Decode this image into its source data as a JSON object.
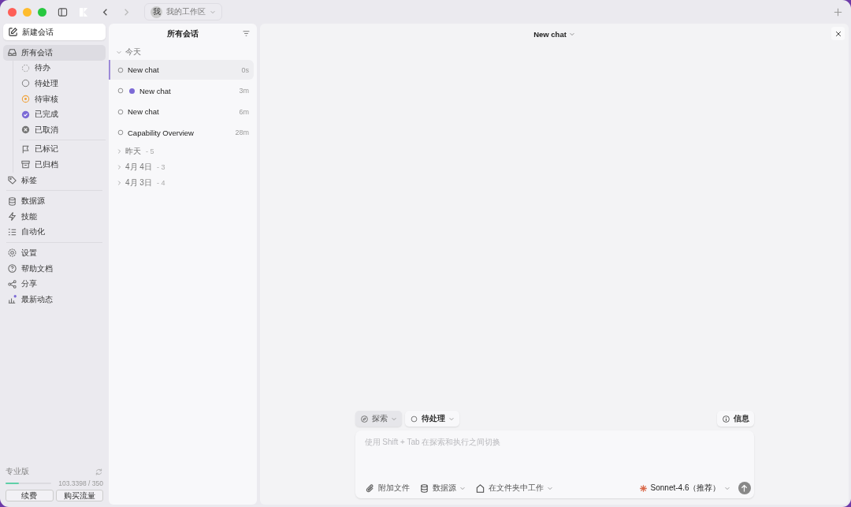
{
  "titlebar": {
    "workspace": "我的工作区",
    "workspace_initial": "我"
  },
  "sidebar": {
    "new_chat": "新建会话",
    "all": {
      "label": "所有会话",
      "selected": true
    },
    "statuses": [
      {
        "label": "待办",
        "kind": "todo"
      },
      {
        "label": "待处理",
        "kind": "pending"
      },
      {
        "label": "待审核",
        "kind": "review"
      },
      {
        "label": "已完成",
        "kind": "done"
      },
      {
        "label": "已取消",
        "kind": "cancelled"
      }
    ],
    "marks": [
      {
        "label": "已标记",
        "kind": "flag"
      },
      {
        "label": "已归档",
        "kind": "archive"
      }
    ],
    "groups": [
      [
        {
          "label": "标签",
          "kind": "tag"
        }
      ],
      [
        {
          "label": "数据源",
          "kind": "database"
        },
        {
          "label": "技能",
          "kind": "bolt"
        },
        {
          "label": "自动化",
          "kind": "list"
        }
      ],
      [
        {
          "label": "设置",
          "kind": "gear"
        },
        {
          "label": "帮助文档",
          "kind": "help"
        },
        {
          "label": "分享",
          "kind": "share"
        },
        {
          "label": "最新动态",
          "kind": "news"
        }
      ]
    ],
    "plan": {
      "name": "专业版",
      "level": 0.3,
      "usage": "103.3398 / 350",
      "renew": "续费",
      "buy": "购买流量"
    }
  },
  "sessions": {
    "title": "所有会话",
    "today": "今天",
    "items": [
      {
        "title": "New chat",
        "time": "0s",
        "selected": true,
        "unread": false
      },
      {
        "title": "New chat",
        "time": "3m",
        "selected": false,
        "unread": true
      },
      {
        "title": "New chat",
        "time": "6m",
        "selected": false,
        "unread": false
      },
      {
        "title": "Capability Overview",
        "time": "28m",
        "selected": false,
        "unread": false
      }
    ],
    "collapsed": [
      {
        "label": "昨天",
        "count": "- 5"
      },
      {
        "label": "4月 4日",
        "count": "- 3"
      },
      {
        "label": "4月 3日",
        "count": "- 4"
      }
    ]
  },
  "chat": {
    "title": "New chat",
    "mode": "探索",
    "status": "待处理",
    "info": "信息",
    "placeholder": "使用 Shift + Tab 在探索和执行之间切换",
    "attach": "附加文件",
    "source": "数据源",
    "folder": "在文件夹中工作",
    "model": "Sonnet-4.6（推荐）"
  }
}
